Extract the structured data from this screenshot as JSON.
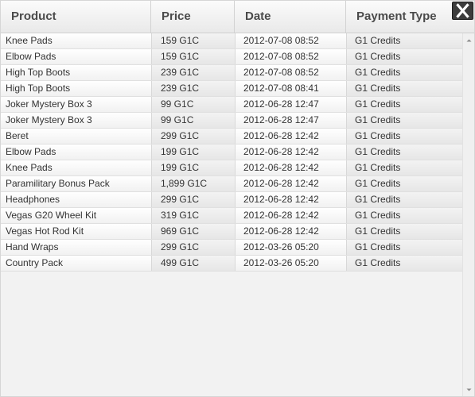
{
  "table": {
    "columns": [
      "Product",
      "Price",
      "Date",
      "Payment Type"
    ],
    "rows": [
      {
        "product": "Knee Pads",
        "price": "159 G1C",
        "date": "2012-07-08 08:52",
        "payment": "G1 Credits"
      },
      {
        "product": "Elbow Pads",
        "price": "159 G1C",
        "date": "2012-07-08 08:52",
        "payment": "G1 Credits"
      },
      {
        "product": "High Top Boots",
        "price": "239 G1C",
        "date": "2012-07-08 08:52",
        "payment": "G1 Credits"
      },
      {
        "product": "High Top Boots",
        "price": "239 G1C",
        "date": "2012-07-08 08:41",
        "payment": "G1 Credits"
      },
      {
        "product": "Joker Mystery Box 3",
        "price": "99 G1C",
        "date": "2012-06-28 12:47",
        "payment": "G1 Credits"
      },
      {
        "product": "Joker Mystery Box 3",
        "price": "99 G1C",
        "date": "2012-06-28 12:47",
        "payment": "G1 Credits"
      },
      {
        "product": "Beret",
        "price": "299 G1C",
        "date": "2012-06-28 12:42",
        "payment": "G1 Credits"
      },
      {
        "product": "Elbow Pads",
        "price": "199 G1C",
        "date": "2012-06-28 12:42",
        "payment": "G1 Credits"
      },
      {
        "product": "Knee Pads",
        "price": "199 G1C",
        "date": "2012-06-28 12:42",
        "payment": "G1 Credits"
      },
      {
        "product": "Paramilitary Bonus Pack",
        "price": "1,899 G1C",
        "date": "2012-06-28 12:42",
        "payment": "G1 Credits"
      },
      {
        "product": "Headphones",
        "price": "299 G1C",
        "date": "2012-06-28 12:42",
        "payment": "G1 Credits"
      },
      {
        "product": "Vegas G20 Wheel Kit",
        "price": "319 G1C",
        "date": "2012-06-28 12:42",
        "payment": "G1 Credits"
      },
      {
        "product": "Vegas Hot Rod Kit",
        "price": "969 G1C",
        "date": "2012-06-28 12:42",
        "payment": "G1 Credits"
      },
      {
        "product": "Hand Wraps",
        "price": "299 G1C",
        "date": "2012-03-26 05:20",
        "payment": "G1 Credits"
      },
      {
        "product": "Country Pack",
        "price": "499 G1C",
        "date": "2012-03-26 05:20",
        "payment": "G1 Credits"
      }
    ]
  },
  "icons": {
    "close": "close-icon",
    "scroll_up": "chevron-up-icon",
    "scroll_down": "chevron-down-icon"
  },
  "colors": {
    "header_text": "#4a4a4a",
    "cell_text": "#333333",
    "close_button_bg": "#3c3c3c"
  }
}
